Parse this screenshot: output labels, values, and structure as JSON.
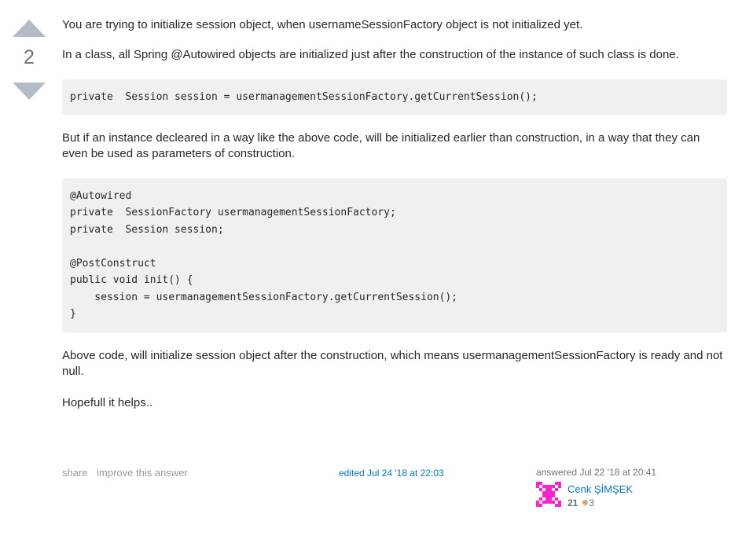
{
  "vote": {
    "up_arrow_icon": "vote-up-triangle-icon",
    "down_arrow_icon": "vote-down-triangle-icon",
    "score": "2"
  },
  "post": {
    "paragraph_1": "You are trying to initialize session object, when usernameSessionFactory object is not initialized yet.",
    "paragraph_2": "In a class, all Spring @Autowired objects are initialized just after the construction of the instance of such class is done.",
    "code_1": "private  Session session = usermanagementSessionFactory.getCurrentSession();",
    "paragraph_3": "But if an instance decleared in a way like the above code, will be initialized earlier than construction, in a way that they can even be used as parameters of construction.",
    "code_2": "@Autowired\nprivate  SessionFactory usermanagementSessionFactory;\nprivate  Session session;\n\n@PostConstruct\npublic void init() {\n    session = usermanagementSessionFactory.getCurrentSession();\n}",
    "paragraph_4": "Above code, will initialize session object after the construction, which means usermanagementSessionFactory is ready and not null.",
    "paragraph_5": "Hopefull it helps.."
  },
  "footer": {
    "share_label": "share",
    "improve_label": "improve this answer",
    "edited_info": "edited Jul 24 '18 at 22:03",
    "answered_info": "answered Jul 22 '18 at 20:41"
  },
  "user": {
    "avatar_icon": "identicon-avatar",
    "username": "Cenk ŞİMŞEK",
    "reputation": "21",
    "bronze_badge_icon": "bronze-badge-dot",
    "bronze_badge_count": "3"
  },
  "colors": {
    "link": "#0077cc",
    "muted": "#6a737c",
    "code_background": "#eff0f1",
    "vote_arrow": "#b3bcc4",
    "bronze_badge": "#d1a684",
    "avatar_accent": "#ff22cc"
  }
}
